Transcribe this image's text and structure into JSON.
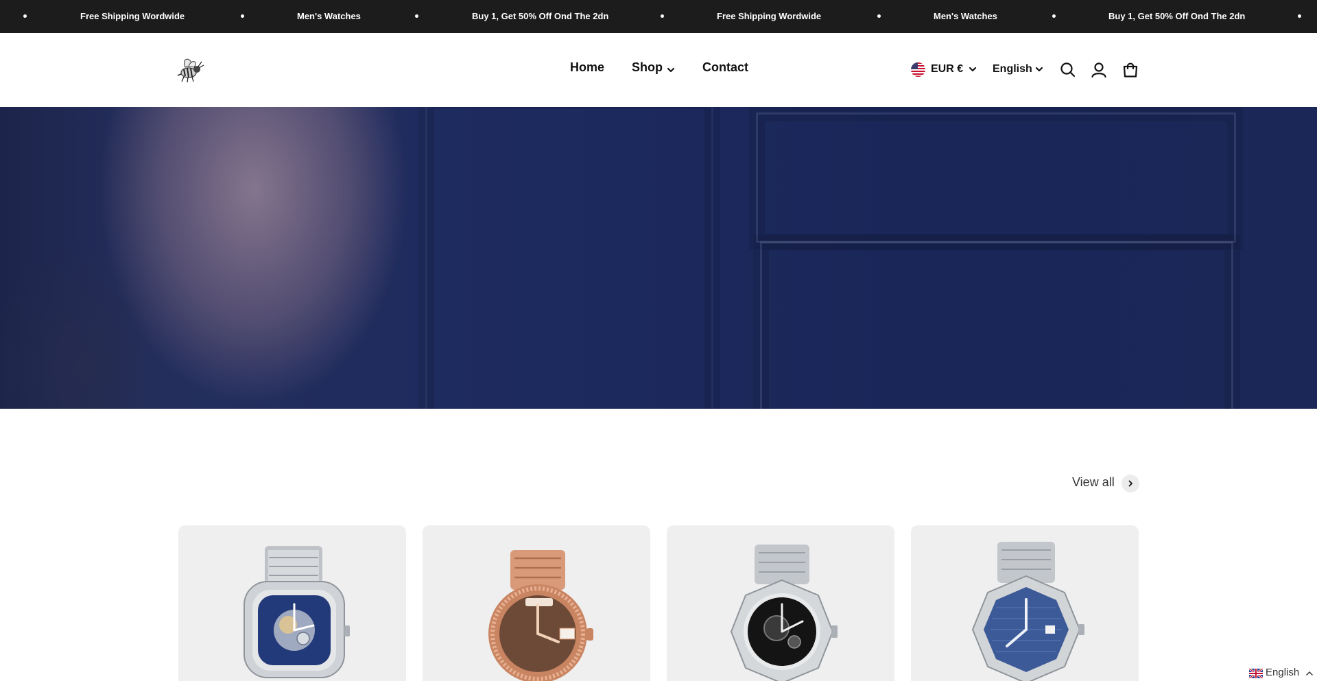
{
  "announcement_bar": {
    "items": [
      "Free Shipping Wordwide",
      "Men's Watches",
      "Buy 1, Get 50% Off Ond The 2dn",
      "Free Shipping Wordwide",
      "Men's Watches",
      "Buy 1, Get 50% Off Ond The 2dn"
    ]
  },
  "header": {
    "logo_icon": "bee-logo-icon",
    "nav": {
      "home": "Home",
      "shop": "Shop",
      "contact": "Contact"
    },
    "currency": "EUR €",
    "language": "English",
    "icons": [
      "us-flag-icon",
      "search-icon",
      "account-icon",
      "cart-icon"
    ]
  },
  "collection": {
    "view_all_label": "View all",
    "products": [
      {
        "icon": "skeleton-watch-blue-dial-icon"
      },
      {
        "icon": "rose-gold-watch-brown-dial-icon"
      },
      {
        "icon": "skeleton-watch-black-dial-icon"
      },
      {
        "icon": "octagon-watch-blue-dial-icon"
      }
    ]
  },
  "language_floater": {
    "label": "English",
    "icon": "uk-flag-icon"
  },
  "colors": {
    "announcement_bg": "#1c1c1c",
    "hero_navy": "#1d2a5e",
    "card_bg": "#efefef"
  }
}
